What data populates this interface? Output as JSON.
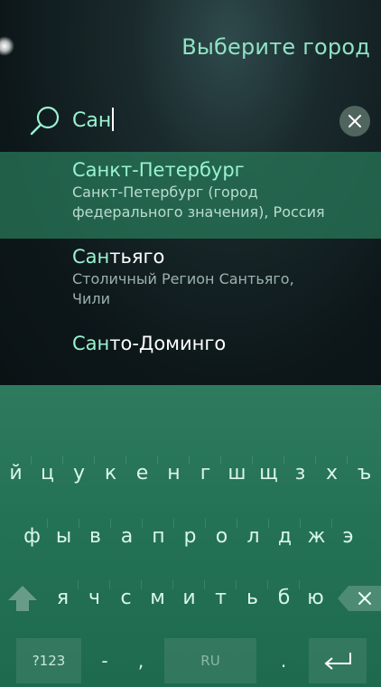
{
  "header": {
    "title": "Выберите город"
  },
  "search": {
    "value": "Сан"
  },
  "results": [
    {
      "highlight": "Санкт-Петербург",
      "rest": "",
      "sub1": "Санкт-Петербург (город",
      "sub2": "федерального значения), Россия"
    },
    {
      "highlight": "Сан",
      "rest": "тьяго",
      "sub1": "Столичный Регион Сантьяго,",
      "sub2": "Чили"
    },
    {
      "highlight": "Сан",
      "rest": "то-Доминго",
      "sub1": "",
      "sub2": ""
    }
  ],
  "keyboard": {
    "row1": [
      "й",
      "ц",
      "у",
      "к",
      "е",
      "н",
      "г",
      "ш",
      "щ",
      "з",
      "х",
      "ъ"
    ],
    "row2": [
      "ф",
      "ы",
      "в",
      "а",
      "п",
      "р",
      "о",
      "л",
      "д",
      "ж",
      "э"
    ],
    "row3": [
      "я",
      "ч",
      "с",
      "м",
      "и",
      "т",
      "ь",
      "б",
      "ю"
    ],
    "symbols_label": "?123",
    "dash": "-",
    "comma": ",",
    "language_label": "RU",
    "period": "."
  },
  "colors": {
    "accent": "#9af2d1",
    "keyboard_bg": "#247255",
    "highlight_row": "#287a5a"
  }
}
